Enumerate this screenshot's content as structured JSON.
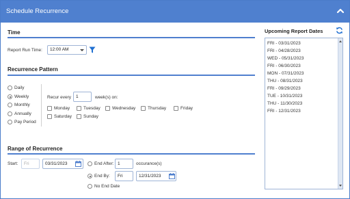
{
  "header": {
    "title": "Schedule Recurrence"
  },
  "time": {
    "section_title": "Time",
    "run_time_label": "Report Run Time:",
    "run_time_value": "12:00 AM"
  },
  "recurrence": {
    "section_title": "Recurrence Pattern",
    "options": [
      "Daily",
      "Weekly",
      "Monthly",
      "Annually",
      "Pay Period"
    ],
    "selected": "Weekly",
    "recur_every_label": "Recur every",
    "recur_every_value": "1",
    "weeks_on_label": "week(s) on:",
    "days": [
      "Monday",
      "Tuesday",
      "Wednesday",
      "Thursday",
      "Friday",
      "Saturday",
      "Sunday"
    ]
  },
  "range": {
    "section_title": "Range of Recurrence",
    "start_label": "Start:",
    "start_day": "Fri",
    "start_date": "03/31/2023",
    "end_after_label": "End After:",
    "end_after_value": "1",
    "occurrences_label": "occurance(s)",
    "end_by_label": "End By:",
    "end_by_day": "Fri",
    "end_by_date": "12/31/2023",
    "no_end_label": "No End Date",
    "selected": "End By"
  },
  "upcoming": {
    "title": "Upcoming Report Dates",
    "dates": [
      "FRI - 03/31/2023",
      "FRI - 04/28/2023",
      "WED - 05/31/2023",
      "FRI - 06/30/2023",
      "MON - 07/31/2023",
      "THU - 08/31/2023",
      "FRI - 09/29/2023",
      "TUE - 10/31/2023",
      "THU - 11/30/2023",
      "FRI - 12/31/2023"
    ]
  },
  "colors": {
    "accent": "#4f80cf",
    "rule": "#4f7fce",
    "filter_icon": "#1f6fd1"
  }
}
